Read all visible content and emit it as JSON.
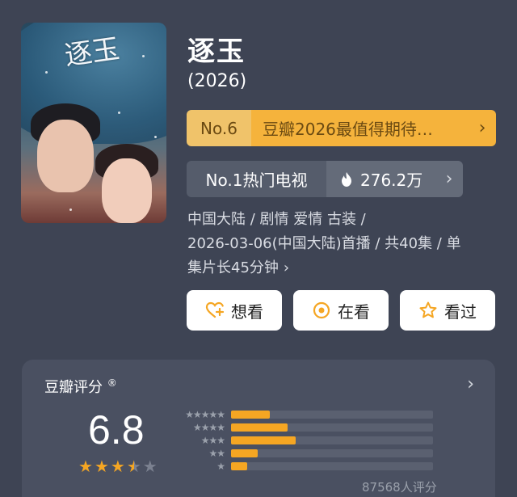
{
  "poster": {
    "title_art": "逐玉"
  },
  "title": "逐玉",
  "year": "(2026)",
  "rank": {
    "number": "No.6",
    "text": "豆瓣2026最值得期待…",
    "arrow": "›"
  },
  "hot": {
    "label": "No.1热门电视",
    "count": "276.2万",
    "arrow": "›"
  },
  "meta": {
    "line1": "中国大陆 / 剧情 爱情 古装 /",
    "line2": "2026-03-06(中国大陆)首播 / 共40集 / 单",
    "line3": "集片长45分钟",
    "chevron": "›"
  },
  "actions": [
    {
      "label": "想看",
      "icon": "heart-plus-icon"
    },
    {
      "label": "在看",
      "icon": "target-icon"
    },
    {
      "label": "看过",
      "icon": "star-outline-icon"
    }
  ],
  "rating": {
    "title": "豆瓣评分",
    "registered_mark": "®",
    "chevron": "›",
    "score": "6.8",
    "stars_filled": 3.5,
    "stars_total": 5,
    "distribution": [
      {
        "stars": "★★★★★",
        "fraction": 0.19
      },
      {
        "stars": "★★★★",
        "fraction": 0.28
      },
      {
        "stars": "★★★",
        "fraction": 0.32
      },
      {
        "stars": "★★",
        "fraction": 0.13
      },
      {
        "stars": "★",
        "fraction": 0.08
      }
    ],
    "count": "87568人评分"
  },
  "colors": {
    "background": "#3e4454",
    "accent": "#f5a623",
    "rank_bar": "#f5b33c"
  }
}
